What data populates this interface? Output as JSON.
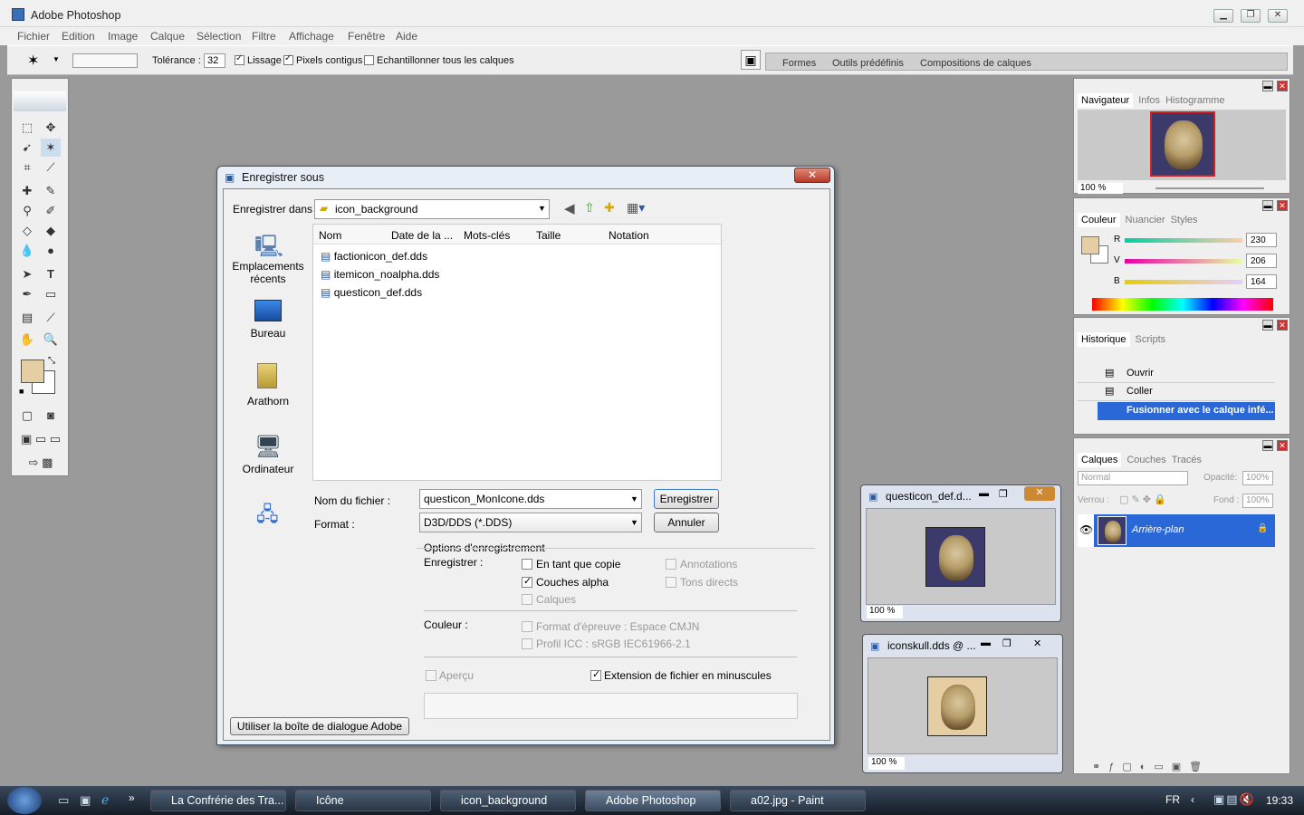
{
  "app": {
    "title": "Adobe Photoshop"
  },
  "menu": [
    "Fichier",
    "Edition",
    "Image",
    "Calque",
    "Sélection",
    "Filtre",
    "Affichage",
    "Fenêtre",
    "Aide"
  ],
  "options": {
    "tolerance_label": "Tolérance :",
    "tolerance_value": "32",
    "lissage": "Lissage",
    "pixels_contigus": "Pixels contigus",
    "echantillonner": "Echantillonner tous les calques",
    "tabs": [
      "Formes",
      "Outils prédéfinis",
      "Compositions de calques"
    ]
  },
  "navigator": {
    "tabs": [
      "Navigateur",
      "Infos",
      "Histogramme"
    ],
    "zoom": "100 %"
  },
  "color": {
    "tabs": [
      "Couleur",
      "Nuancier",
      "Styles"
    ],
    "r_label": "R",
    "r": "230",
    "v_label": "V",
    "v": "206",
    "b_label": "B",
    "b": "164",
    "swatch": "#e6cea4"
  },
  "history": {
    "tabs": [
      "Historique",
      "Scripts"
    ],
    "items": [
      "Ouvrir",
      "Coller",
      "Fusionner avec le calque infé..."
    ]
  },
  "layers": {
    "tabs": [
      "Calques",
      "Couches",
      "Tracés"
    ],
    "mode": "Normal",
    "opacity_label": "Opacité:",
    "opacity": "100%",
    "lock_label": "Verrou :",
    "fill_label": "Fond :",
    "fill": "100%",
    "layer_name": "Arrière-plan"
  },
  "dialog": {
    "title": "Enregistrer sous",
    "save_in_label": "Enregistrer dans :",
    "folder": "icon_background",
    "places": [
      "Emplacements récents",
      "Bureau",
      "Arathorn",
      "Ordinateur"
    ],
    "columns": [
      "Nom",
      "Date de la ...",
      "Mots-clés",
      "Taille",
      "Notation"
    ],
    "files": [
      "factionicon_def.dds",
      "itemicon_noalpha.dds",
      "questicon_def.dds"
    ],
    "filename_label": "Nom du fichier :",
    "filename": "questicon_MonIcone.dds",
    "format_label": "Format :",
    "format": "D3D/DDS (*.DDS)",
    "save_button": "Enregistrer",
    "cancel_button": "Annuler",
    "options_title": "Options d'enregistrement",
    "save_label": "Enregistrer :",
    "as_copy": "En tant que copie",
    "alpha": "Couches alpha",
    "layers": "Calques",
    "annotations": "Annotations",
    "spot": "Tons directs",
    "color_label": "Couleur :",
    "proof": "Format d'épreuve : Espace CMJN",
    "icc": "Profil ICC : sRGB IEC61966-2.1",
    "preview": "Aperçu",
    "ext_lower": "Extension de fichier en minuscules",
    "adobe_dialog": "Utiliser la boîte de dialogue Adobe"
  },
  "docs": [
    {
      "title": "questicon_def.d...",
      "zoom": "100 %"
    },
    {
      "title": "iconskull.dds @ ...",
      "zoom": "100 %"
    }
  ],
  "taskbar": {
    "items": [
      "La Confrérie des Tra...",
      "Icône",
      "icon_background",
      "Adobe Photoshop",
      "a02.jpg - Paint"
    ],
    "lang": "FR",
    "time": "19:33"
  }
}
